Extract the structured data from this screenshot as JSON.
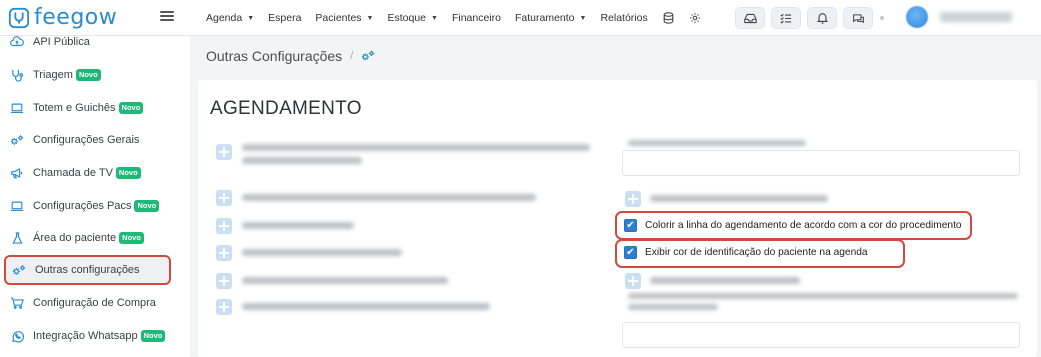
{
  "app": {
    "brand": "feegow",
    "brand_color": "#2a8ccf",
    "highlight_color": "#d24a3a",
    "badge_color": "#1fb977"
  },
  "topnav": {
    "items": [
      {
        "label": "Agenda",
        "dropdown": true
      },
      {
        "label": "Espera",
        "dropdown": false
      },
      {
        "label": "Pacientes",
        "dropdown": true
      },
      {
        "label": "Estoque",
        "dropdown": true
      },
      {
        "label": "Financeiro",
        "dropdown": false
      },
      {
        "label": "Faturamento",
        "dropdown": true
      },
      {
        "label": "Relatórios",
        "dropdown": false
      }
    ],
    "icons": [
      "database-icon",
      "gear-icon"
    ],
    "action_buttons": [
      "inbox-icon",
      "checklist-icon",
      "bell-icon",
      "chat-icon"
    ]
  },
  "sidebar": {
    "badge_label": "Novo",
    "items": [
      {
        "label": "API Pública",
        "icon": "cloud-icon",
        "badge": false
      },
      {
        "label": "Triagem",
        "icon": "stethoscope-icon",
        "badge": true
      },
      {
        "label": "Totem e Guichês",
        "icon": "laptop-icon",
        "badge": true
      },
      {
        "label": "Configurações Gerais",
        "icon": "gears-icon",
        "badge": false
      },
      {
        "label": "Chamada de TV",
        "icon": "megaphone-icon",
        "badge": true
      },
      {
        "label": "Configurações Pacs",
        "icon": "laptop-icon",
        "badge": true
      },
      {
        "label": "Área do paciente",
        "icon": "flask-icon",
        "badge": true
      },
      {
        "label": "Outras configurações",
        "icon": "gears-icon",
        "badge": false,
        "active": true
      },
      {
        "label": "Configuração de Compra",
        "icon": "cart-icon",
        "badge": false
      },
      {
        "label": "Integração Whatsapp",
        "icon": "whatsapp-icon",
        "badge": true
      }
    ]
  },
  "main": {
    "breadcrumb": "Outras Configurações",
    "breadcrumb_sep": "/",
    "section_title": "AGENDAMENTO",
    "checkboxes": [
      {
        "label": "Colorir a linha do agendamento de acordo com a cor do procedimento",
        "checked": true
      },
      {
        "label": "Exibir cor de identificação do paciente na agenda",
        "checked": true
      }
    ]
  }
}
